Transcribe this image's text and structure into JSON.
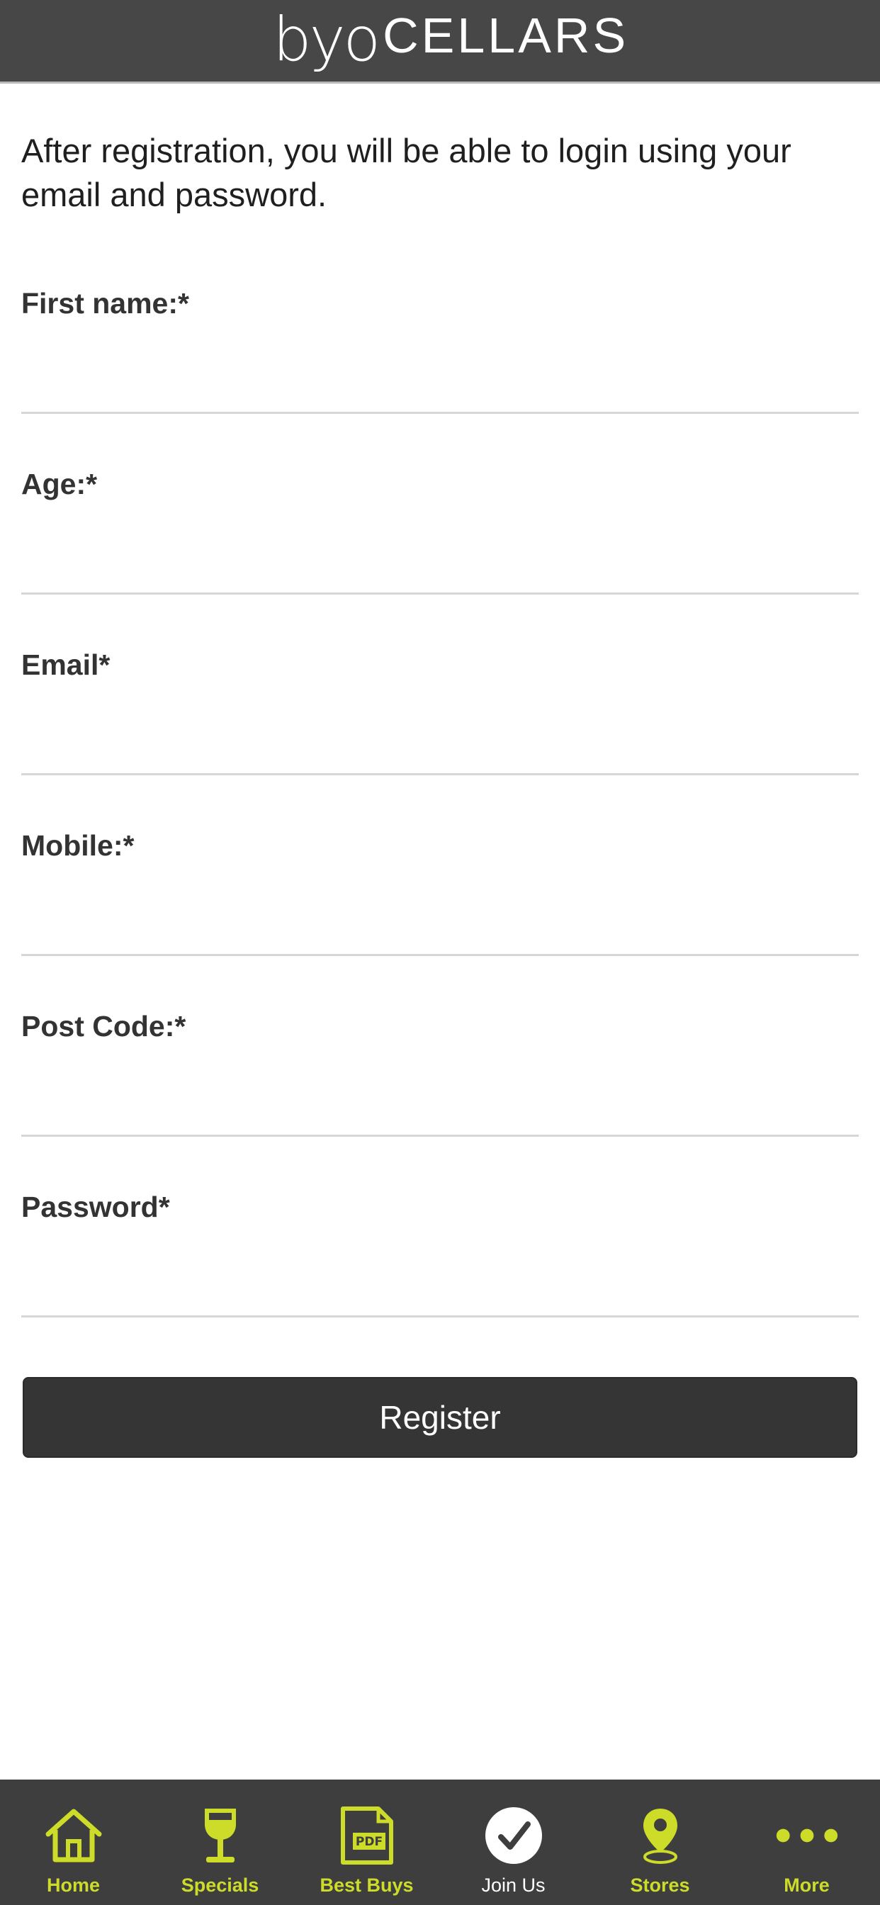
{
  "colors": {
    "header_bg": "#474747",
    "tabbar_bg": "#3e3e3e",
    "accent": "#cddc28",
    "button_bg": "#353535",
    "active_tab_label": "#ffffff"
  },
  "header": {
    "logo_mark": "byo",
    "logo_word": "CELLARS"
  },
  "intro": {
    "text": "After registration, you will be able to login using your email and password."
  },
  "form": {
    "fields": [
      {
        "label": "First name:*",
        "value": ""
      },
      {
        "label": "Age:*",
        "value": ""
      },
      {
        "label": "Email*",
        "value": ""
      },
      {
        "label": "Mobile:*",
        "value": ""
      },
      {
        "label": "Post Code:*",
        "value": ""
      },
      {
        "label": "Password*",
        "value": ""
      }
    ],
    "submit_label": "Register"
  },
  "tabbar": {
    "tabs": [
      {
        "label": "Home",
        "icon": "house-icon",
        "active": false
      },
      {
        "label": "Specials",
        "icon": "wine-glass-icon",
        "active": false
      },
      {
        "label": "Best Buys",
        "icon": "pdf-document-icon",
        "active": false
      },
      {
        "label": "Join Us",
        "icon": "checkmark-circle-icon",
        "active": true
      },
      {
        "label": "Stores",
        "icon": "map-pin-icon",
        "active": false
      },
      {
        "label": "More",
        "icon": "more-dots-icon",
        "active": false
      }
    ]
  }
}
